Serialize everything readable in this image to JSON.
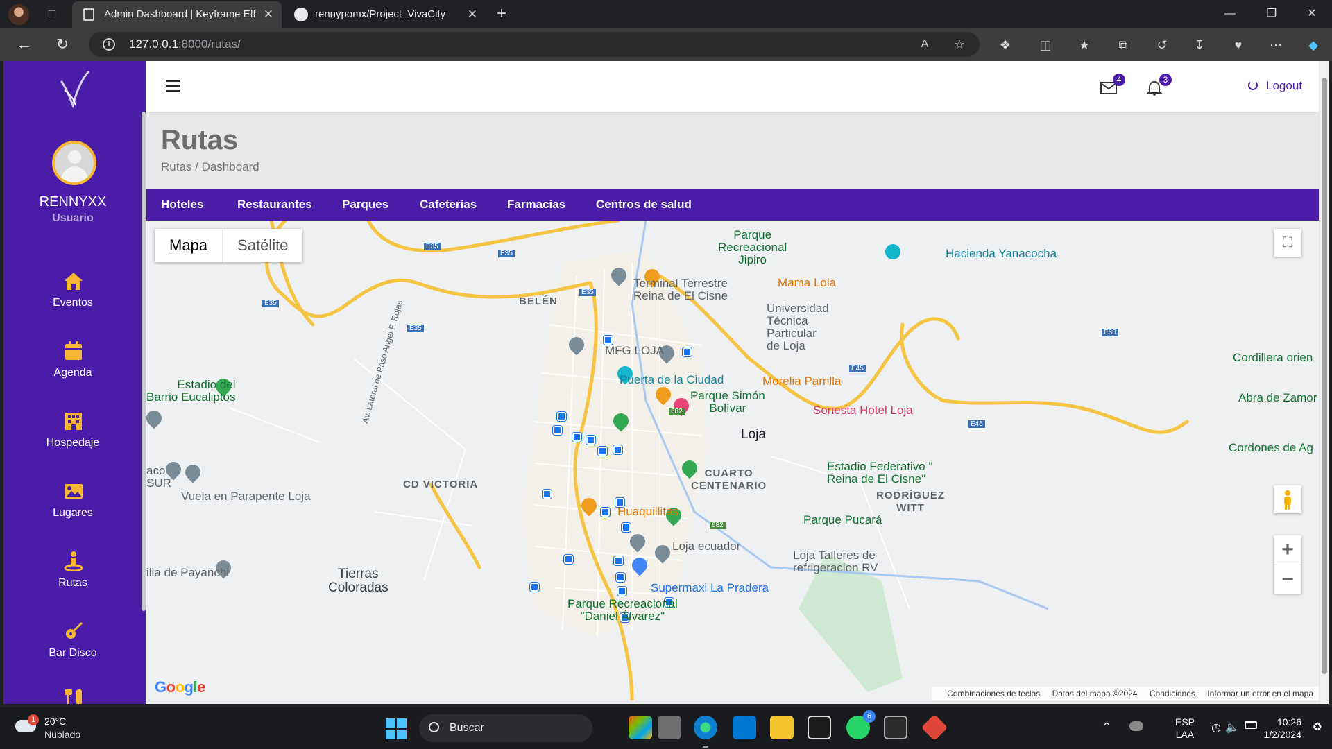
{
  "browser": {
    "tabs": [
      {
        "title": "Admin Dashboard | Keyframe Eff",
        "active": true
      },
      {
        "title": "rennypomx/Project_VivaCity",
        "active": false
      }
    ],
    "url_host": "127.0.0.1",
    "url_path": ":8000/rutas/"
  },
  "sidebar": {
    "username": "RENNYXX",
    "role": "Usuario",
    "items": [
      {
        "label": "Eventos",
        "icon": "home-icon"
      },
      {
        "label": "Agenda",
        "icon": "calendar-icon"
      },
      {
        "label": "Hospedaje",
        "icon": "building-icon"
      },
      {
        "label": "Lugares",
        "icon": "image-icon"
      },
      {
        "label": "Rutas",
        "icon": "person-pin-icon"
      },
      {
        "label": "Bar Disco",
        "icon": "guitar-icon"
      }
    ]
  },
  "topbar": {
    "messages_count": "4",
    "notifications_count": "3",
    "logout_label": "Logout"
  },
  "page": {
    "title": "Rutas",
    "breadcrumb": "Rutas / Dashboard"
  },
  "categories": [
    "Hoteles",
    "Restaurantes",
    "Parques",
    "Cafeterías",
    "Farmacias",
    "Centros de salud"
  ],
  "map": {
    "type_map": "Mapa",
    "type_satellite": "Satélite",
    "labels": {
      "parque_jipiro": "Parque\nRecreacional\nJipiro",
      "hacienda": "Hacienda Yanacocha",
      "terminal": "Terminal Terrestre\nReina de El Cisne",
      "mama_lola": "Mama Lola",
      "belen": "BELÉN",
      "utpl": "Universidad\nTécnica\nParticular\nde Loja",
      "mfg": "MFG LOJA",
      "cordillera": "Cordillera orien",
      "estadio_barrio": "Estadio del\nBarrio Eucaliptos",
      "puerta": "Puerta de la Ciudad",
      "morelia": "Morelia Parrilla",
      "simon": "Parque Simón\nBolívar",
      "sonesta": "Sonesta Hotel Loja",
      "abra": "Abra de Zamor",
      "loja": "Loja",
      "cordones": "Cordones de Ag",
      "avenida": "Av. Lateral de Paso Angel F. Rojas",
      "aco": "aco\nSUR",
      "parapente": "Vuela en Parapente Loja",
      "victoria": "CD VICTORIA",
      "cuarto": "CUARTO\nCENTENARIO",
      "federativo": "Estadio Federativo \"\nReina de El Cisne\"",
      "rodriguez": "RODRÍGUEZ\nWITT",
      "huaquillitas": "Huaquillitas",
      "pucara": "Parque Pucará",
      "loja_ecuador": "Loja ecuador",
      "talleres": "Loja Talleres de\nrefrigeracion RV",
      "payanchi": "illa de Payanchi",
      "tierras": "Tierras\nColoradas",
      "supermaxi": "Supermaxi La Pradera",
      "daniel": "Parque Recreacional\n\"Daniel Álvarez\""
    },
    "road_shields": [
      "E35",
      "E35",
      "E35",
      "E35",
      "E35",
      "E50",
      "E45",
      "E45",
      "682",
      "682"
    ],
    "attribution": {
      "shortcuts": "Combinaciones de teclas",
      "data": "Datos del mapa ©2024",
      "terms": "Condiciones",
      "report": "Informar un error en el mapa"
    },
    "google": "Google"
  },
  "taskbar": {
    "weather_temp": "20°C",
    "weather_cond": "Nublado",
    "weather_alert": "1",
    "search": "Buscar",
    "whatsapp_badge": "6",
    "lang_1": "ESP",
    "lang_2": "LAA",
    "time": "10:26",
    "date": "1/2/2024"
  },
  "colors": {
    "brand": "#4a1ca7",
    "avatar_ring": "#f7b733",
    "road": "#f6c443",
    "water": "#a9c9f0"
  }
}
